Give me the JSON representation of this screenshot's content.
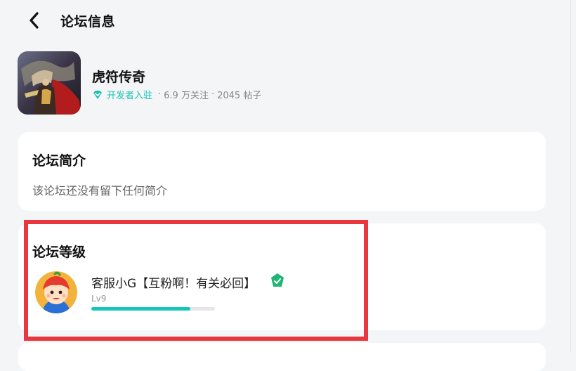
{
  "header": {
    "title": "论坛信息",
    "back_icon": "chevron-left-icon"
  },
  "game": {
    "name": "虎符传奇",
    "developer_label": "开发者入驻",
    "followers": "6.9 万关注",
    "posts": "2045 帖子",
    "separator": "·",
    "accent": "#17c2b4"
  },
  "intro": {
    "title": "论坛简介",
    "text": "该论坛还没有留下任何简介"
  },
  "level": {
    "title": "论坛等级",
    "user": "客服小G【互粉啊！有关必回】",
    "level": "Lv9",
    "progress": 0.8,
    "progress_color": "#14c6b8"
  },
  "highlight_color": "#e8373f"
}
